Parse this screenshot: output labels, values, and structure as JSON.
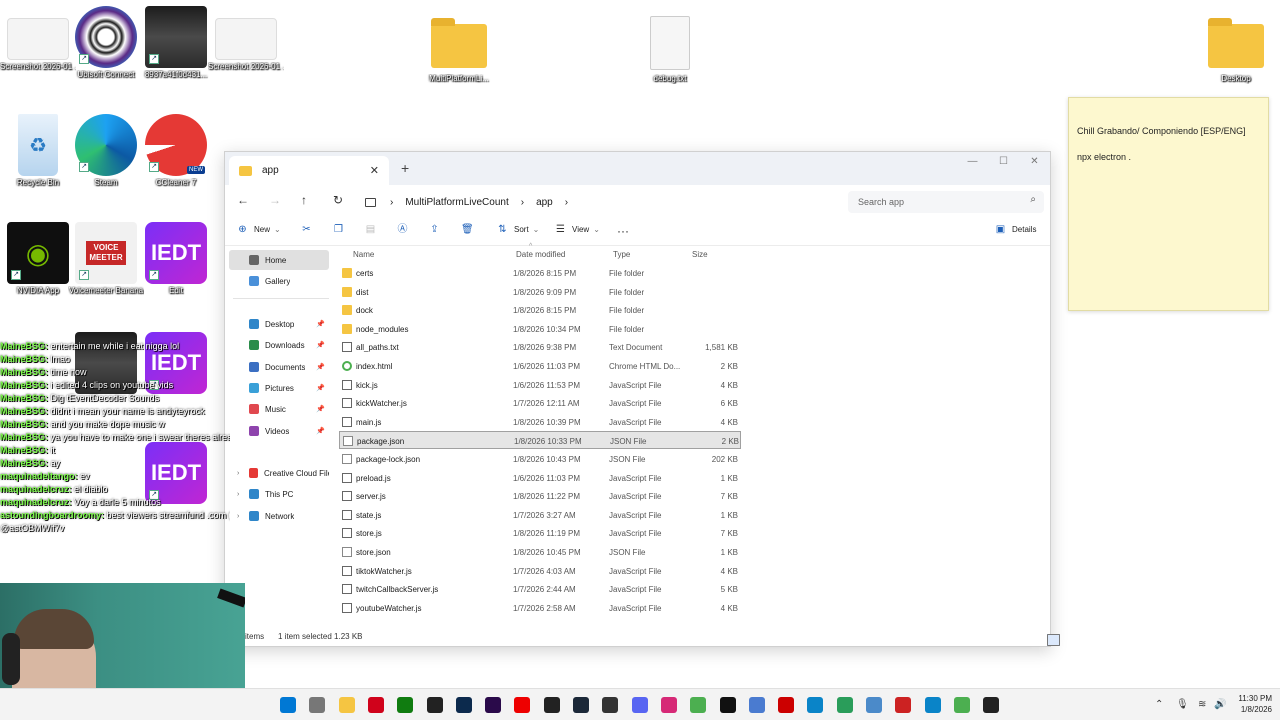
{
  "desktop": {
    "icons": [
      {
        "label": "Screenshot 2026-01 ...",
        "kind": "thumb-white"
      },
      {
        "label": "Ubisoft Connect",
        "kind": "ubisoft"
      },
      {
        "label": "8937a41f0d431...",
        "kind": "photo"
      },
      {
        "label": "Screenshot 2026-01 ...",
        "kind": "thumb-white"
      },
      {
        "label": "MultiPlatformLi...",
        "kind": "folder"
      },
      {
        "label": "debug.txt",
        "kind": "doc"
      },
      {
        "label": "Desktop",
        "kind": "folder"
      },
      {
        "label": "Recycle Bin",
        "kind": "recycle"
      },
      {
        "label": "Steam",
        "kind": "edge"
      },
      {
        "label": "CCleaner 7",
        "kind": "ccleaner"
      },
      {
        "label": "NVIDIA App",
        "kind": "nvidia"
      },
      {
        "label": "Voicemeeter Banana",
        "kind": "voicemeeter"
      },
      {
        "label": "Edit",
        "kind": "iedt"
      },
      {
        "label": "",
        "kind": "photo2"
      },
      {
        "label": "",
        "kind": "iedt"
      },
      {
        "label": "",
        "kind": "iedt"
      }
    ],
    "voicemeeter_text": "VOICE MEETER",
    "iedt_text": "IEDT",
    "new_badge": "NEW"
  },
  "sticky_note": {
    "lines": [
      "Chill Grabando/ Componiendo [ESP/ENG]",
      "npx electron ."
    ]
  },
  "explorer": {
    "tab_title": "app",
    "new_tab": "+",
    "breadcrumb": [
      "MultiPlatformLiveCount",
      "app"
    ],
    "search_placeholder": "Search app",
    "toolbar": {
      "new": "New",
      "sort": "Sort",
      "view": "View",
      "more": "···",
      "details": "Details"
    },
    "nav": [
      {
        "label": "Home",
        "selected": true
      },
      {
        "label": "Gallery"
      },
      {
        "label": "Desktop",
        "pinned": true
      },
      {
        "label": "Downloads",
        "pinned": true
      },
      {
        "label": "Documents",
        "pinned": true
      },
      {
        "label": "Pictures",
        "pinned": true
      },
      {
        "label": "Music",
        "pinned": true
      },
      {
        "label": "Videos",
        "pinned": true
      },
      {
        "label": "Creative Cloud Files",
        "expandable": true
      },
      {
        "label": "This PC",
        "expandable": true
      },
      {
        "label": "Network",
        "expandable": true
      }
    ],
    "columns": [
      "Name",
      "Date modified",
      "Type",
      "Size"
    ],
    "files": [
      {
        "name": "certs",
        "date": "1/8/2026 8:15 PM",
        "type": "File folder",
        "size": "",
        "icon": "folder"
      },
      {
        "name": "dist",
        "date": "1/8/2026 9:09 PM",
        "type": "File folder",
        "size": "",
        "icon": "folder"
      },
      {
        "name": "dock",
        "date": "1/8/2026 8:15 PM",
        "type": "File folder",
        "size": "",
        "icon": "folder"
      },
      {
        "name": "node_modules",
        "date": "1/8/2026 10:34 PM",
        "type": "File folder",
        "size": "",
        "icon": "folder"
      },
      {
        "name": "all_paths.txt",
        "date": "1/8/2026 9:38 PM",
        "type": "Text Document",
        "size": "1,581 KB",
        "icon": "file"
      },
      {
        "name": "index.html",
        "date": "1/6/2026 11:03 PM",
        "type": "Chrome HTML Do...",
        "size": "2 KB",
        "icon": "html"
      },
      {
        "name": "kick.js",
        "date": "1/6/2026 11:53 PM",
        "type": "JavaScript File",
        "size": "4 KB",
        "icon": "file"
      },
      {
        "name": "kickWatcher.js",
        "date": "1/7/2026 12:11 AM",
        "type": "JavaScript File",
        "size": "6 KB",
        "icon": "file"
      },
      {
        "name": "main.js",
        "date": "1/8/2026 10:39 PM",
        "type": "JavaScript File",
        "size": "4 KB",
        "icon": "file"
      },
      {
        "name": "package.json",
        "date": "1/8/2026 10:33 PM",
        "type": "JSON File",
        "size": "2 KB",
        "icon": "json",
        "selected": true
      },
      {
        "name": "package-lock.json",
        "date": "1/8/2026 10:43 PM",
        "type": "JSON File",
        "size": "202 KB",
        "icon": "json"
      },
      {
        "name": "preload.js",
        "date": "1/6/2026 11:03 PM",
        "type": "JavaScript File",
        "size": "1 KB",
        "icon": "file"
      },
      {
        "name": "server.js",
        "date": "1/8/2026 11:22 PM",
        "type": "JavaScript File",
        "size": "7 KB",
        "icon": "file"
      },
      {
        "name": "state.js",
        "date": "1/7/2026 3:27 AM",
        "type": "JavaScript File",
        "size": "1 KB",
        "icon": "file"
      },
      {
        "name": "store.js",
        "date": "1/8/2026 11:19 PM",
        "type": "JavaScript File",
        "size": "7 KB",
        "icon": "file"
      },
      {
        "name": "store.json",
        "date": "1/8/2026 10:45 PM",
        "type": "JSON File",
        "size": "1 KB",
        "icon": "json"
      },
      {
        "name": "tiktokWatcher.js",
        "date": "1/7/2026 4:03 AM",
        "type": "JavaScript File",
        "size": "4 KB",
        "icon": "file"
      },
      {
        "name": "twitchCallbackServer.js",
        "date": "1/7/2026 2:44 AM",
        "type": "JavaScript File",
        "size": "5 KB",
        "icon": "file"
      },
      {
        "name": "youtubeWatcher.js",
        "date": "1/7/2026 2:58 AM",
        "type": "JavaScript File",
        "size": "4 KB",
        "icon": "file"
      }
    ],
    "status": {
      "items": "items",
      "selected": "1 item selected  1.23 KB"
    }
  },
  "chat": [
    {
      "user": "MaineBSG:",
      "msg": "entertain me while i eat nigga lol"
    },
    {
      "user": "MaineBSG:",
      "msg": "lmao"
    },
    {
      "user": "MaineBSG:",
      "msg": "time now"
    },
    {
      "user": "MaineBSG:",
      "msg": "i edited 4 clips on youtube vids"
    },
    {
      "user": "MaineBSG:",
      "msg": "Dig tEventDecoder Sounds"
    },
    {
      "user": "MaineBSG:",
      "msg": "didnt i mean your name is andyteyrock"
    },
    {
      "user": "MaineBSG:",
      "msg": "and you make dope music w"
    },
    {
      "user": "MaineBSG:",
      "msg": "ya you have to make one i swear theres already one out there"
    },
    {
      "user": "MaineBSG:",
      "msg": "it"
    },
    {
      "user": "MaineBSG:",
      "msg": "ay"
    },
    {
      "user": "maquinadeltango:",
      "msg": "ev"
    },
    {
      "user": "maquinadelcruz:",
      "msg": "el diablo"
    },
    {
      "user": "maquinadelcruz:",
      "msg": "Voy a darle 5 minutos"
    },
    {
      "user": "astoundingboardroomy:",
      "msg": "best viewers streamfund .com (remove the space)"
    },
    {
      "user": "",
      "msg": "@astOBMWif7v"
    }
  ],
  "taskbar": {
    "icons": [
      "windows",
      "explorer-folder",
      "file-explorer",
      "opera",
      "xbox",
      "epic",
      "photoshop",
      "premiere",
      "youtube",
      "epic-games",
      "steam",
      "obs",
      "discord",
      "instagram",
      "chrome",
      "tiktok",
      "app-blue",
      "app-red",
      "edge",
      "sticky",
      "app-photo",
      "app-red2",
      "edge2",
      "notes",
      "davinci"
    ],
    "colors": [
      "#0078d4",
      "#777",
      "#f5c542",
      "#d0021b",
      "#107c10",
      "#222",
      "#0c2a4d",
      "#2a0a4a",
      "#e00",
      "#222",
      "#1b2838",
      "#333",
      "#5865f2",
      "#d62976",
      "#4caf50",
      "#111",
      "#4a7bd0",
      "#c00",
      "#0a84c8",
      "#2a9d5a",
      "#4b8ac9",
      "#c22",
      "#0a84c8",
      "#4caf50",
      "#222"
    ],
    "time": "11:30 PM",
    "date": "1/8/2026"
  }
}
